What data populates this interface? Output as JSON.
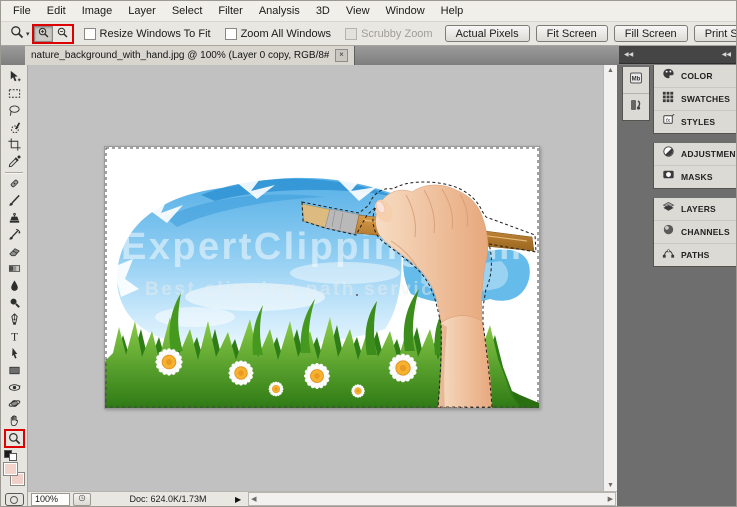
{
  "menubar": {
    "items": [
      "File",
      "Edit",
      "Image",
      "Layer",
      "Select",
      "Filter",
      "Analysis",
      "3D",
      "View",
      "Window",
      "Help"
    ]
  },
  "options_bar": {
    "checkboxes": [
      {
        "label": "Resize Windows To Fit",
        "checked": false,
        "disabled": false
      },
      {
        "label": "Zoom All Windows",
        "checked": false,
        "disabled": false
      },
      {
        "label": "Scrubby Zoom",
        "checked": false,
        "disabled": true
      }
    ],
    "buttons": [
      {
        "label": "Actual Pixels"
      },
      {
        "label": "Fit Screen"
      },
      {
        "label": "Fill Screen"
      },
      {
        "label": "Print Size"
      }
    ]
  },
  "document_tab": {
    "title": "nature_background_with_hand.jpg @ 100% (Layer 0 copy, RGB/8#) *",
    "close": "×"
  },
  "toolbar": {
    "tools": [
      {
        "name": "move-tool"
      },
      {
        "name": "rectangular-marquee-tool"
      },
      {
        "name": "lasso-tool"
      },
      {
        "name": "quick-selection-tool"
      },
      {
        "name": "crop-tool"
      },
      {
        "name": "eyedropper-tool"
      },
      {
        "name": "spot-healing-brush-tool"
      },
      {
        "name": "brush-tool"
      },
      {
        "name": "clone-stamp-tool"
      },
      {
        "name": "history-brush-tool"
      },
      {
        "name": "eraser-tool"
      },
      {
        "name": "gradient-tool"
      },
      {
        "name": "blur-tool"
      },
      {
        "name": "dodge-tool"
      },
      {
        "name": "pen-tool"
      },
      {
        "name": "type-tool"
      },
      {
        "name": "path-selection-tool"
      },
      {
        "name": "rectangle-tool"
      },
      {
        "name": "3d-rotate-tool"
      },
      {
        "name": "3d-orbit-tool"
      },
      {
        "name": "hand-tool"
      },
      {
        "name": "zoom-tool",
        "highlighted": true
      }
    ],
    "foreground_color": "#f2d4cd",
    "background_color": "#f0d0c9"
  },
  "canvas": {
    "watermark_title": "ExpertClipping.com",
    "watermark_subtitle": "Best clipping path service"
  },
  "dock": {
    "collapsed_icons": [
      {
        "name": "mini-bridge-panel",
        "icon": "mini-bridge"
      },
      {
        "name": "history-panel",
        "icon": "history"
      }
    ],
    "panel_groups": [
      {
        "panels": [
          {
            "icon": "color",
            "label": "COLOR"
          },
          {
            "icon": "swatches",
            "label": "SWATCHES"
          },
          {
            "icon": "styles",
            "label": "STYLES"
          }
        ]
      },
      {
        "panels": [
          {
            "icon": "adjustments",
            "label": "ADJUSTMENTS"
          },
          {
            "icon": "masks",
            "label": "MASKS"
          }
        ]
      },
      {
        "panels": [
          {
            "icon": "layers",
            "label": "LAYERS"
          },
          {
            "icon": "channels",
            "label": "CHANNELS"
          },
          {
            "icon": "paths",
            "label": "PATHS"
          }
        ]
      }
    ]
  },
  "status_bar": {
    "zoom_value": "100%",
    "doc_info": "Doc: 624.0K/1.73M"
  },
  "colors": {
    "highlight_red": "#dd0000",
    "dock_bg": "#6e6e6e",
    "canvas_bg": "#c0c0c0"
  }
}
